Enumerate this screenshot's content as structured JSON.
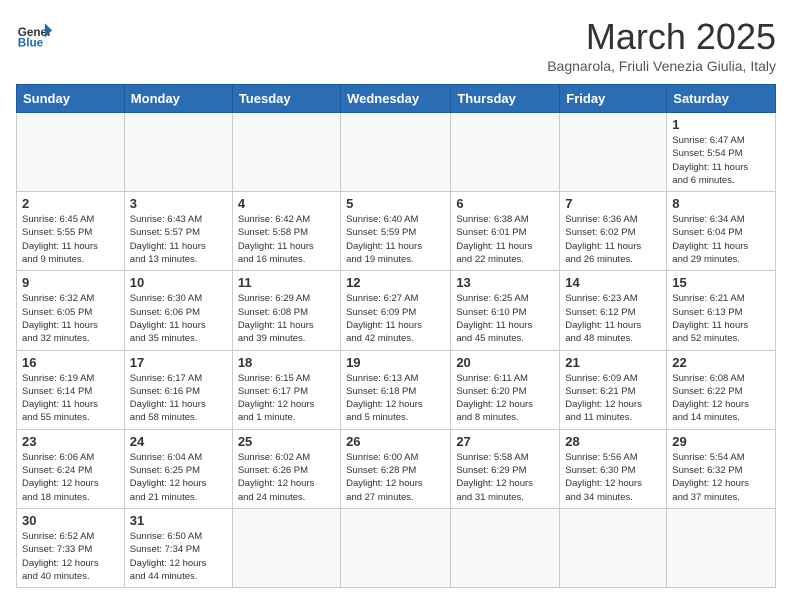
{
  "header": {
    "logo_general": "General",
    "logo_blue": "Blue",
    "month_title": "March 2025",
    "subtitle": "Bagnarola, Friuli Venezia Giulia, Italy"
  },
  "weekdays": [
    "Sunday",
    "Monday",
    "Tuesday",
    "Wednesday",
    "Thursday",
    "Friday",
    "Saturday"
  ],
  "weeks": [
    [
      {
        "day": "",
        "info": ""
      },
      {
        "day": "",
        "info": ""
      },
      {
        "day": "",
        "info": ""
      },
      {
        "day": "",
        "info": ""
      },
      {
        "day": "",
        "info": ""
      },
      {
        "day": "",
        "info": ""
      },
      {
        "day": "1",
        "info": "Sunrise: 6:47 AM\nSunset: 5:54 PM\nDaylight: 11 hours\nand 6 minutes."
      }
    ],
    [
      {
        "day": "2",
        "info": "Sunrise: 6:45 AM\nSunset: 5:55 PM\nDaylight: 11 hours\nand 9 minutes."
      },
      {
        "day": "3",
        "info": "Sunrise: 6:43 AM\nSunset: 5:57 PM\nDaylight: 11 hours\nand 13 minutes."
      },
      {
        "day": "4",
        "info": "Sunrise: 6:42 AM\nSunset: 5:58 PM\nDaylight: 11 hours\nand 16 minutes."
      },
      {
        "day": "5",
        "info": "Sunrise: 6:40 AM\nSunset: 5:59 PM\nDaylight: 11 hours\nand 19 minutes."
      },
      {
        "day": "6",
        "info": "Sunrise: 6:38 AM\nSunset: 6:01 PM\nDaylight: 11 hours\nand 22 minutes."
      },
      {
        "day": "7",
        "info": "Sunrise: 6:36 AM\nSunset: 6:02 PM\nDaylight: 11 hours\nand 26 minutes."
      },
      {
        "day": "8",
        "info": "Sunrise: 6:34 AM\nSunset: 6:04 PM\nDaylight: 11 hours\nand 29 minutes."
      }
    ],
    [
      {
        "day": "9",
        "info": "Sunrise: 6:32 AM\nSunset: 6:05 PM\nDaylight: 11 hours\nand 32 minutes."
      },
      {
        "day": "10",
        "info": "Sunrise: 6:30 AM\nSunset: 6:06 PM\nDaylight: 11 hours\nand 35 minutes."
      },
      {
        "day": "11",
        "info": "Sunrise: 6:29 AM\nSunset: 6:08 PM\nDaylight: 11 hours\nand 39 minutes."
      },
      {
        "day": "12",
        "info": "Sunrise: 6:27 AM\nSunset: 6:09 PM\nDaylight: 11 hours\nand 42 minutes."
      },
      {
        "day": "13",
        "info": "Sunrise: 6:25 AM\nSunset: 6:10 PM\nDaylight: 11 hours\nand 45 minutes."
      },
      {
        "day": "14",
        "info": "Sunrise: 6:23 AM\nSunset: 6:12 PM\nDaylight: 11 hours\nand 48 minutes."
      },
      {
        "day": "15",
        "info": "Sunrise: 6:21 AM\nSunset: 6:13 PM\nDaylight: 11 hours\nand 52 minutes."
      }
    ],
    [
      {
        "day": "16",
        "info": "Sunrise: 6:19 AM\nSunset: 6:14 PM\nDaylight: 11 hours\nand 55 minutes."
      },
      {
        "day": "17",
        "info": "Sunrise: 6:17 AM\nSunset: 6:16 PM\nDaylight: 11 hours\nand 58 minutes."
      },
      {
        "day": "18",
        "info": "Sunrise: 6:15 AM\nSunset: 6:17 PM\nDaylight: 12 hours\nand 1 minute."
      },
      {
        "day": "19",
        "info": "Sunrise: 6:13 AM\nSunset: 6:18 PM\nDaylight: 12 hours\nand 5 minutes."
      },
      {
        "day": "20",
        "info": "Sunrise: 6:11 AM\nSunset: 6:20 PM\nDaylight: 12 hours\nand 8 minutes."
      },
      {
        "day": "21",
        "info": "Sunrise: 6:09 AM\nSunset: 6:21 PM\nDaylight: 12 hours\nand 11 minutes."
      },
      {
        "day": "22",
        "info": "Sunrise: 6:08 AM\nSunset: 6:22 PM\nDaylight: 12 hours\nand 14 minutes."
      }
    ],
    [
      {
        "day": "23",
        "info": "Sunrise: 6:06 AM\nSunset: 6:24 PM\nDaylight: 12 hours\nand 18 minutes."
      },
      {
        "day": "24",
        "info": "Sunrise: 6:04 AM\nSunset: 6:25 PM\nDaylight: 12 hours\nand 21 minutes."
      },
      {
        "day": "25",
        "info": "Sunrise: 6:02 AM\nSunset: 6:26 PM\nDaylight: 12 hours\nand 24 minutes."
      },
      {
        "day": "26",
        "info": "Sunrise: 6:00 AM\nSunset: 6:28 PM\nDaylight: 12 hours\nand 27 minutes."
      },
      {
        "day": "27",
        "info": "Sunrise: 5:58 AM\nSunset: 6:29 PM\nDaylight: 12 hours\nand 31 minutes."
      },
      {
        "day": "28",
        "info": "Sunrise: 5:56 AM\nSunset: 6:30 PM\nDaylight: 12 hours\nand 34 minutes."
      },
      {
        "day": "29",
        "info": "Sunrise: 5:54 AM\nSunset: 6:32 PM\nDaylight: 12 hours\nand 37 minutes."
      }
    ],
    [
      {
        "day": "30",
        "info": "Sunrise: 6:52 AM\nSunset: 7:33 PM\nDaylight: 12 hours\nand 40 minutes."
      },
      {
        "day": "31",
        "info": "Sunrise: 6:50 AM\nSunset: 7:34 PM\nDaylight: 12 hours\nand 44 minutes."
      },
      {
        "day": "",
        "info": ""
      },
      {
        "day": "",
        "info": ""
      },
      {
        "day": "",
        "info": ""
      },
      {
        "day": "",
        "info": ""
      },
      {
        "day": "",
        "info": ""
      }
    ]
  ]
}
